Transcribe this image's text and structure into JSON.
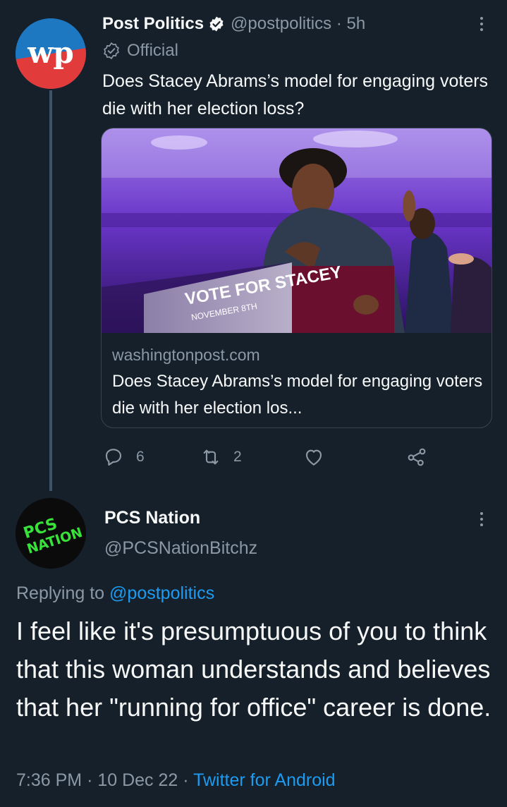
{
  "tweet1": {
    "display_name": "Post Politics",
    "handle": "@postpolitics",
    "separator": "·",
    "time": "5h",
    "official_label": "Official",
    "text": "Does Stacey Abrams’s model for engaging voters die with her election loss?",
    "avatar_icon": "washington-post-logo",
    "card": {
      "domain": "washingtonpost.com",
      "title": "Does Stacey Abrams’s model for engaging voters die with her election los...",
      "image_text_1": "VOTE FOR STACEY",
      "image_text_2": "NOVEMBER 8TH"
    },
    "actions": {
      "replies": "6",
      "retweets": "2",
      "likes": "",
      "share": ""
    }
  },
  "tweet2": {
    "display_name": "PCS Nation",
    "handle": "@PCSNationBitchz",
    "avatar_text_1": "PCS",
    "avatar_text_2": "NATION",
    "replying_prefix": "Replying to",
    "replying_to": "@postpolitics",
    "text": "I feel like it's presumptuous of you to think that this woman understands and believes that her \"running for office\" career is done.",
    "time": "7:36 PM",
    "date": "10 Dec 22",
    "separator": "·",
    "source": "Twitter for Android"
  },
  "colors": {
    "background": "#15202b",
    "text_primary": "#f7f9f9",
    "text_secondary": "#8b98a5",
    "link": "#1d9bf0",
    "border": "#38444d"
  }
}
